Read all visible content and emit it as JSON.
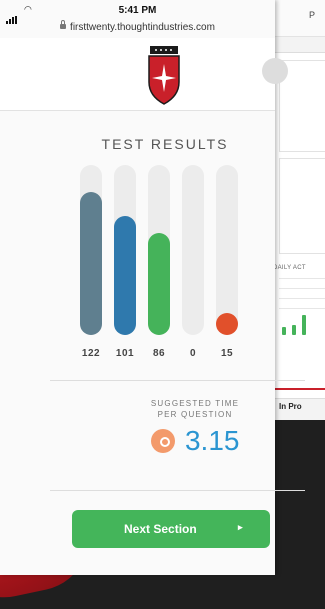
{
  "status_bar": {
    "time": "5:41 PM",
    "url": "firsttwenty.thoughtindustries.com"
  },
  "background_card": {
    "top_letter": "P",
    "daily_label": "DAILY ACT",
    "tab_label": "In Pro"
  },
  "results": {
    "title": "TEST RESULTS",
    "bars": [
      {
        "value": "122",
        "level": 0.84,
        "color": "#5f7f8f"
      },
      {
        "value": "101",
        "level": 0.7,
        "color": "#2f79ad"
      },
      {
        "value": "86",
        "level": 0.6,
        "color": "#45b35a"
      },
      {
        "value": "0",
        "level": 0.0,
        "color": "#ececec"
      },
      {
        "value": "15",
        "level": 0.12,
        "color": "#e1502b"
      }
    ]
  },
  "suggested": {
    "label": "SUGGESTED TIME\nPER QUESTION",
    "value": "3.15",
    "icon": "clock-icon"
  },
  "actions": {
    "next_label": "Next Section",
    "next_arrow": "▸"
  }
}
